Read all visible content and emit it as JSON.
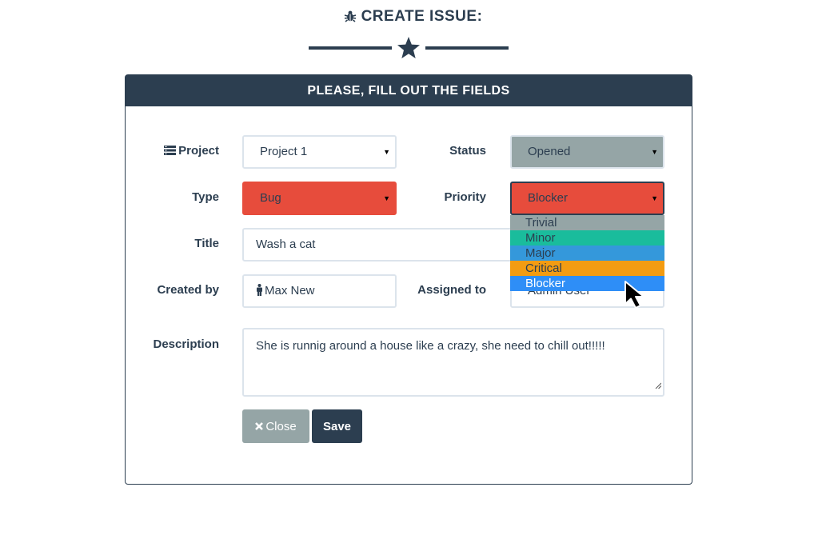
{
  "page": {
    "title": "CREATE ISSUE:"
  },
  "panel": {
    "heading": "PLEASE, FILL OUT THE FIELDS"
  },
  "form": {
    "project": {
      "label": "Project",
      "value": "Project 1"
    },
    "status": {
      "label": "Status",
      "value": "Opened"
    },
    "type": {
      "label": "Type",
      "value": "Bug"
    },
    "priority": {
      "label": "Priority",
      "value": "Blocker",
      "options": [
        {
          "label": "Trivial",
          "color": "#95a5a6"
        },
        {
          "label": "Minor",
          "color": "#1abc9c"
        },
        {
          "label": "Major",
          "color": "#3498db"
        },
        {
          "label": "Critical",
          "color": "#f39c12"
        },
        {
          "label": "Blocker",
          "color": "#2e8ef7"
        }
      ],
      "highlighted": "Blocker"
    },
    "title": {
      "label": "Title",
      "value": "Wash a cat"
    },
    "created_by": {
      "label": "Created by",
      "value": "Max New"
    },
    "assigned_to": {
      "label": "Assigned to",
      "value": "Admin User"
    },
    "description": {
      "label": "Description",
      "value": "She is runnig around a house like a crazy, she need to chill out!!!!!"
    }
  },
  "buttons": {
    "close_label": "Close",
    "save_label": "Save"
  },
  "colors": {
    "primary": "#2c3e50",
    "danger": "#e74c3c",
    "muted": "#95a5a6"
  },
  "icons": {
    "title": "bug-icon",
    "divider": "star-icon",
    "project": "server-icon",
    "user": "male-icon",
    "close": "x-icon"
  }
}
